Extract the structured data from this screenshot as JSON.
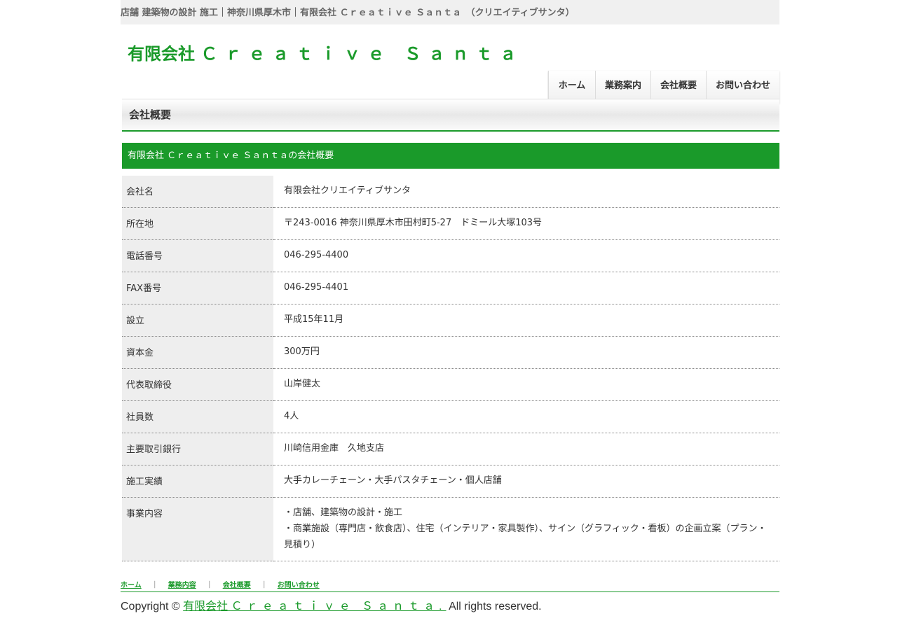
{
  "topbar": {
    "text": "店舗 建築物の設計 施工｜神奈川県厚木市｜有限会社 Ｃｒｅａｔｉｖｅ Ｓａｎｔａ　（クリエイティブサンタ）"
  },
  "logo": {
    "prefix": "有限会社 ",
    "name": "Ｃｒｅａｔｉｖｅ Ｓａｎｔａ"
  },
  "nav": {
    "home": "ホーム",
    "services": "業務案内",
    "company": "会社概要",
    "contact": "お問い合わせ"
  },
  "page": {
    "title": "会社概要"
  },
  "section": {
    "title": "有限会社 Ｃｒｅａｔｉｖｅ Ｓａｎｔａの会社概要"
  },
  "company": {
    "name": {
      "label": "会社名",
      "value": "有限会社クリエイティブサンタ"
    },
    "address": {
      "label": "所在地",
      "value": "〒243-0016 神奈川県厚木市田村町5-27　ドミール大塚103号"
    },
    "phone": {
      "label": "電話番号",
      "value": "046-295-4400"
    },
    "fax": {
      "label": "FAX番号",
      "value": "046-295-4401"
    },
    "founded": {
      "label": "設立",
      "value": "平成15年11月"
    },
    "capital": {
      "label": "資本金",
      "value": "300万円"
    },
    "ceo": {
      "label": "代表取締役",
      "value": "山岸健太"
    },
    "employees": {
      "label": "社員数",
      "value": "4人"
    },
    "bank": {
      "label": "主要取引銀行",
      "value": "川崎信用金庫　久地支店"
    },
    "works": {
      "label": "施工実績",
      "value": "大手カレーチェーン・大手パスタチェーン・個人店舗"
    },
    "business": {
      "label": "事業内容",
      "line1": "・店舗、建築物の設計・施工",
      "line2": "・商業施設（専門店・飲食店）、住宅（インテリア・家具製作）、サイン（グラフィック・看板）の企画立案（プラン・見積り）"
    }
  },
  "footer": {
    "nav": {
      "home": "ホーム",
      "services": "業務内容",
      "company": "会社概要",
      "contact": "お問い合わせ",
      "separator": "｜"
    },
    "copyright_prefix": "Copyright © ",
    "company_prefix": "有限会社 ",
    "company_name": "Ｃｒｅａｔｉｖｅ Ｓａｎｔａ.",
    "copyright_suffix": " All rights reserved."
  },
  "colors": {
    "brand_green": "#1a9a2a",
    "topbar_bg": "#f0f0f0",
    "label_bg": "#eeeeee"
  }
}
